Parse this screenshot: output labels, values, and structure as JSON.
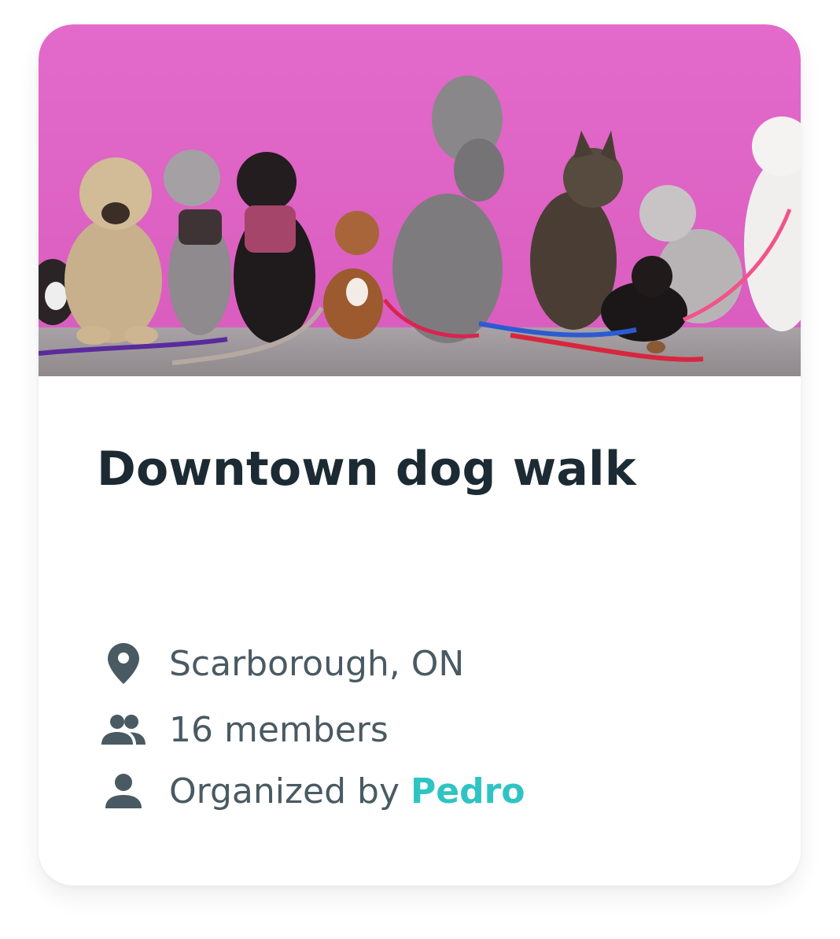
{
  "card": {
    "title": "Downtown dog walk",
    "image_alt": "Group of dogs sitting against a pink wall",
    "location": "Scarborough, ON",
    "members": "16 members",
    "organizer_prefix": "Organized by ",
    "organizer_name": "Pedro"
  },
  "icons": {
    "location": "location-pin-icon",
    "members": "group-icon",
    "organizer": "person-icon"
  },
  "colors": {
    "title": "#1c2b33",
    "meta_text": "#4a5a63",
    "icon": "#4a5a63",
    "link": "#2fc4c4",
    "hero_wall": "#e163c7"
  }
}
